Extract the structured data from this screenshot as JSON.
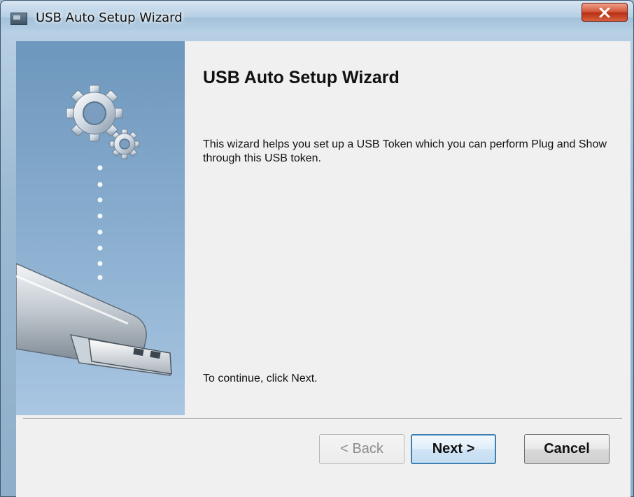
{
  "window": {
    "title": "USB Auto Setup Wizard",
    "icon": "wizard-app-icon",
    "close_icon": "close-x-icon"
  },
  "content": {
    "heading": "USB Auto Setup Wizard",
    "description": "This wizard helps you set up a USB Token which you can perform Plug and Show through this USB token.",
    "continue_text": "To continue, click Next."
  },
  "buttons": {
    "back": "< Back",
    "next": "Next >",
    "cancel": "Cancel"
  },
  "colors": {
    "title_bar": "#b6cfe4",
    "close_button": "#c7391a",
    "side_panel": "#86abcd",
    "default_button_border": "#3c7fb1"
  },
  "illustration": {
    "icons": [
      "gear-icon",
      "usb-drive-icon"
    ]
  }
}
